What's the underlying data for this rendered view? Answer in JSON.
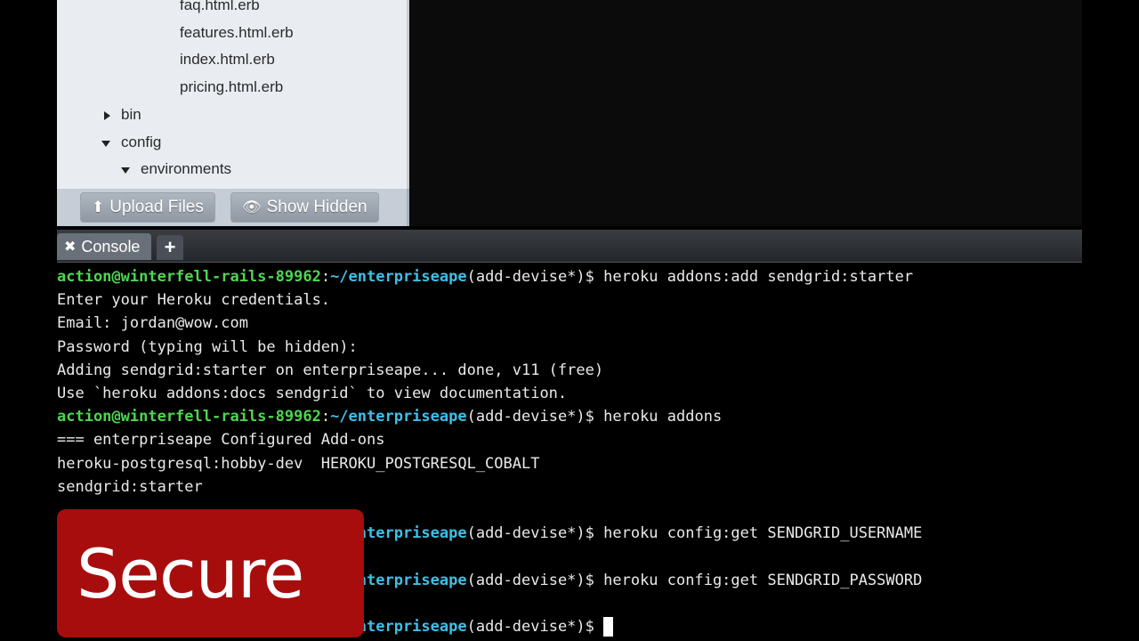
{
  "file_tree": {
    "items": [
      {
        "label": "faq.html.erb",
        "indent": 3,
        "arrow": "none"
      },
      {
        "label": "features.html.erb",
        "indent": 3,
        "arrow": "none"
      },
      {
        "label": "index.html.erb",
        "indent": 3,
        "arrow": "none"
      },
      {
        "label": "pricing.html.erb",
        "indent": 3,
        "arrow": "none"
      },
      {
        "label": "bin",
        "indent": 1,
        "arrow": "right"
      },
      {
        "label": "config",
        "indent": 1,
        "arrow": "down"
      },
      {
        "label": "environments",
        "indent": 2,
        "arrow": "down"
      }
    ],
    "upload_label": "Upload Files",
    "show_hidden_label": "Show Hidden"
  },
  "console": {
    "tab_label": "Console",
    "add_tab_symbol": "+",
    "prompt_user": "action@winterfell-rails-89962",
    "prompt_sep": ":",
    "prompt_path": "~/enterpriseape",
    "prompt_branch": "(add-devise*)$ ",
    "lines": [
      {
        "type": "prompt",
        "cmd": "heroku addons:add sendgrid:starter"
      },
      {
        "type": "out",
        "text": "Enter your Heroku credentials."
      },
      {
        "type": "out",
        "text": "Email: jordan@wow.com"
      },
      {
        "type": "out",
        "text": "Password (typing will be hidden):"
      },
      {
        "type": "out",
        "text": "Adding sendgrid:starter on enterpriseape... done, v11 (free)"
      },
      {
        "type": "out",
        "text": "Use `heroku addons:docs sendgrid` to view documentation."
      },
      {
        "type": "prompt",
        "cmd": "heroku addons"
      },
      {
        "type": "out",
        "text": "=== enterpriseape Configured Add-ons"
      },
      {
        "type": "out",
        "text": "heroku-postgresql:hobby-dev  HEROKU_POSTGRESQL_COBALT"
      },
      {
        "type": "out",
        "text": "sendgrid:starter"
      },
      {
        "type": "blank"
      },
      {
        "type": "prompt",
        "cmd": "heroku config:get SENDGRID_USERNAME"
      },
      {
        "type": "blank"
      },
      {
        "type": "prompt",
        "cmd": "heroku config:get SENDGRID_PASSWORD"
      },
      {
        "type": "blank"
      },
      {
        "type": "prompt",
        "cmd": "",
        "cursor": true
      }
    ]
  },
  "overlay": {
    "label": "Secure",
    "color": "#a80d0d"
  },
  "colors": {
    "prompt_user": "#4fd54f",
    "prompt_path": "#3cc0e8",
    "terminal_bg": "#000000"
  },
  "icons": {
    "upload": "upload-icon",
    "eye": "eye-icon",
    "close": "close-icon"
  }
}
